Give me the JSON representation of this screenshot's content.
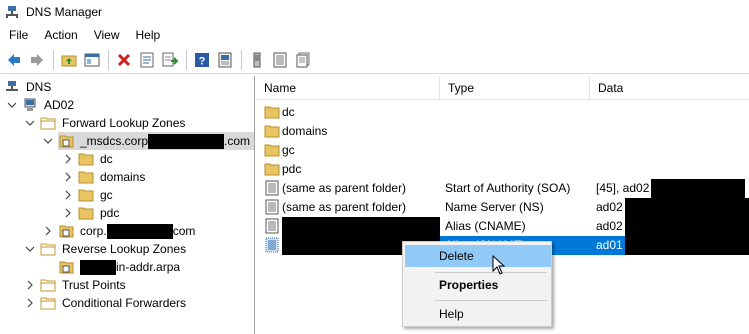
{
  "window": {
    "title": "DNS Manager",
    "icon": "dns-manager-icon"
  },
  "menu": [
    "File",
    "Action",
    "View",
    "Help"
  ],
  "toolbar": {
    "buttons": [
      "back-arrow-icon",
      "forward-arrow-icon",
      "up-folder-icon",
      "show-hide-tree-icon",
      "delete-icon",
      "properties-icon",
      "export-list-icon",
      "help-icon",
      "server-icon",
      "zone-icon",
      "zone-copy-icon"
    ]
  },
  "tree": {
    "root": "DNS",
    "server": "AD02",
    "forward_zones": "Forward Lookup Zones",
    "msdcs_prefix": "_msdcs.corp",
    "msdcs_suffix": ".com",
    "msdcs_children": [
      "dc",
      "domains",
      "gc",
      "pdc"
    ],
    "corp_prefix": "corp.",
    "corp_suffix": "com",
    "reverse_zones": "Reverse Lookup Zones",
    "reverse_suffix": "in-addr.arpa",
    "trust_points": "Trust Points",
    "conditional_forwarders": "Conditional Forwarders"
  },
  "list": {
    "columns": [
      "Name",
      "Type",
      "Data"
    ],
    "rows": [
      {
        "name": "dc",
        "type": "",
        "data": "",
        "icon": "folder-icon"
      },
      {
        "name": "domains",
        "type": "",
        "data": "",
        "icon": "folder-icon"
      },
      {
        "name": "gc",
        "type": "",
        "data": "",
        "icon": "folder-icon"
      },
      {
        "name": "pdc",
        "type": "",
        "data": "",
        "icon": "folder-icon"
      },
      {
        "name": "(same as parent folder)",
        "type": "Start of Authority (SOA)",
        "data": "[45], ad02",
        "icon": "record-icon"
      },
      {
        "name": "(same as parent folder)",
        "type": "Name Server (NS)",
        "data": "ad02",
        "icon": "record-icon"
      },
      {
        "name": "",
        "type": "Alias (CNAME)",
        "data": "ad02",
        "icon": "record-icon"
      },
      {
        "name": "",
        "type": "Alias (CNAME)",
        "data": "ad01",
        "icon": "record-icon",
        "selected": true
      }
    ]
  },
  "context_menu": {
    "items": [
      "Delete",
      "Properties",
      "Help"
    ]
  },
  "colors": {
    "selection": "#0078d7",
    "menu_hover": "#91c9f7",
    "folder": "#e8c462"
  }
}
